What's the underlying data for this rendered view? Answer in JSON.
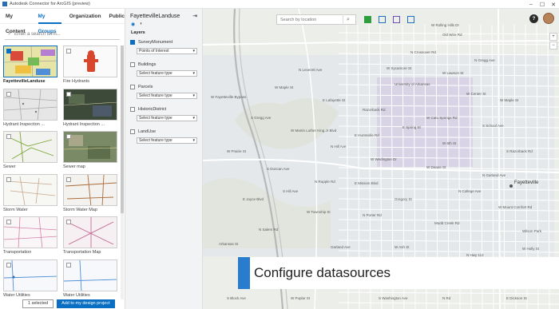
{
  "window": {
    "title": "Autodesk Connector for ArcGIS (preview)",
    "controls": [
      "–",
      "☐",
      "✕"
    ]
  },
  "left": {
    "tabs": [
      {
        "label": "My Content",
        "active": false
      },
      {
        "label": "My Groups",
        "active": true
      },
      {
        "label": "Organization",
        "active": false
      },
      {
        "label": "Public",
        "active": false
      }
    ],
    "search_placeholder": "Enter a search term...",
    "items": [
      {
        "label": "FayettevilleLanduse",
        "selected": true,
        "style": "landuse"
      },
      {
        "label": "Fire Hydrants",
        "selected": false,
        "style": "hydrant"
      },
      {
        "label": "Hydrant Inspection ...",
        "selected": false,
        "style": "gray"
      },
      {
        "label": "Hydrant Inspection ...",
        "selected": false,
        "style": "dark"
      },
      {
        "label": "Sewer",
        "selected": false,
        "style": "green"
      },
      {
        "label": "Sewer map",
        "selected": false,
        "style": "photo"
      },
      {
        "label": "Storm Water",
        "selected": false,
        "style": "lines"
      },
      {
        "label": "Storm Water Map",
        "selected": false,
        "style": "brown"
      },
      {
        "label": "Transportation",
        "selected": false,
        "style": "pink"
      },
      {
        "label": "Transportation Map",
        "selected": false,
        "style": "pinkmap"
      },
      {
        "label": "Water Utilities",
        "selected": false,
        "style": "blue"
      },
      {
        "label": "Water Utilities",
        "selected": false,
        "style": "blue2"
      }
    ],
    "footer": {
      "selected_count": "1 selected",
      "add_button": "Add to my design project"
    }
  },
  "middle": {
    "title": "FayettevilleLanduse",
    "tabs": [
      "layers-icon",
      "basemap-icon"
    ],
    "layers_heading": "Layers",
    "layers": [
      {
        "name": "SurveyMonument",
        "checked": true,
        "select_value": "Points of Interest"
      },
      {
        "name": "Buildings",
        "checked": false,
        "select_value": "Select feature type"
      },
      {
        "name": "Parcels",
        "checked": false,
        "select_value": "Select feature type"
      },
      {
        "name": "HistoricDistrict",
        "checked": false,
        "select_value": "Select feature type"
      },
      {
        "name": "LandUse",
        "checked": false,
        "select_value": "Select feature type"
      }
    ]
  },
  "map": {
    "search_placeholder": "Search by location",
    "help_label": "?",
    "zoom_in": "+",
    "zoom_out": "−",
    "city_label": "Fayetteville",
    "street_labels": [
      "W Rolling Hills Dr",
      "Old Wire Rd",
      "N Crossover Rd",
      "N Gregg Ave",
      "W Sycamore St",
      "W Lawson St",
      "University of Arkansas",
      "W Center St",
      "W Maple St",
      "Razorback Rd",
      "W Cato Springs Rd",
      "S School Ave",
      "E Huntsville Rd",
      "W 6th St",
      "S Razorback Rd",
      "W Wedington Dr",
      "W Deane St",
      "N Garland Ave",
      "E Mission Blvd",
      "N College Ave",
      "Gregory St",
      "W Mount Comfort Rd",
      "N Porter Rd",
      "Mudd Creek Rd",
      "Wilson Park",
      "N Leverett Ave",
      "W Maple St",
      "E Lafayette St",
      "S Gregg Ave",
      "W Martin Luther King Jr Blvd",
      "W Prairie St",
      "S Duncan Ave",
      "N Rupple Rd",
      "E Joyce Blvd",
      "W Township St",
      "N Salem Rd",
      "Arkansas St",
      "Garland Ave",
      "W Ash St",
      "N Hwy 112",
      "W Holly St",
      "W Fayetteville Bypass",
      "N Hill Ave",
      "S Hill Ave",
      "E Spring St",
      "S Washington Ave",
      "N Rd",
      "S Block Ave",
      "W Poplar St",
      "E Dickson St"
    ],
    "tool_colors": [
      "#2e9e3e",
      "#1f70c1",
      "#6b4fb3",
      "#1f70c1"
    ]
  },
  "overlay": {
    "banner_text": "Configure datasources",
    "accent": "#2a7ccf"
  }
}
